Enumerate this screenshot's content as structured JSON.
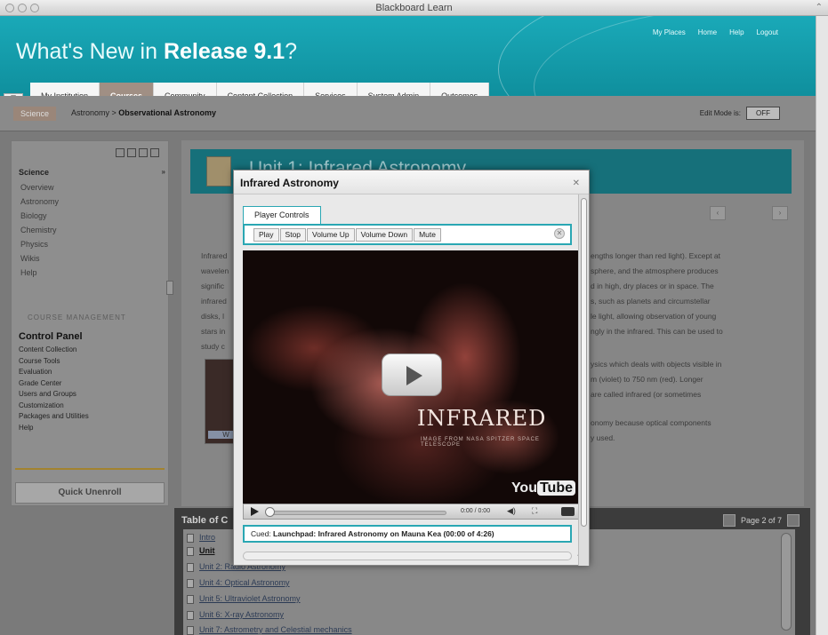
{
  "window": {
    "title": "Blackboard Learn"
  },
  "header": {
    "title_prefix": "What's New in ",
    "title_bold": "Release 9.1",
    "title_suffix": "?",
    "top_links": [
      "My Places",
      "Home",
      "Help",
      "Logout"
    ]
  },
  "tabs": [
    {
      "label": "My Institution",
      "active": false
    },
    {
      "label": "Courses",
      "active": true
    },
    {
      "label": "Community",
      "active": false
    },
    {
      "label": "Content Collection",
      "active": false
    },
    {
      "label": "Services",
      "active": false
    },
    {
      "label": "System Admin",
      "active": false
    },
    {
      "label": "Outcomes",
      "active": false
    }
  ],
  "breadcrumb": {
    "pill": "Science",
    "path": "Astronomy",
    "separator": " > ",
    "current": "Observational Astronomy",
    "edit_mode_label": "Edit Mode is:",
    "edit_mode_value": "OFF"
  },
  "sidebar": {
    "heading": "Science",
    "items": [
      "Overview",
      "Astronomy",
      "Biology",
      "Chemistry",
      "Physics",
      "Wikis",
      "Help"
    ],
    "course_management_label": "COURSE MANAGEMENT",
    "control_panel": "Control Panel",
    "cp_items": [
      "Content Collection",
      "Course Tools",
      "Evaluation",
      "Grade Center",
      "Users and Groups",
      "Customization",
      "Packages and Utilities",
      "Help"
    ],
    "quick_unenroll": "Quick Unenroll"
  },
  "content": {
    "unit_title": "Unit 1: Infrared Astronomy",
    "left_text": [
      "Infrared",
      "wavelen",
      "signific",
      "infrared",
      "disks, l",
      "stars in",
      "study c"
    ],
    "right_text": [
      "engths longer than red light). Except at",
      "sphere, and the atmosphere produces",
      "d in high, dry places or in space. The",
      "s, such as planets and circumstellar",
      "le light, allowing observation of young",
      "ngly in the infrared. This can be used to"
    ],
    "right_text2": [
      "ysics which deals with objects visible in",
      "m (violet) to 750 nm (red). Longer",
      "are called infrared (or sometimes"
    ],
    "right_text3": [
      "onomy because optical components",
      "y used."
    ],
    "thumb_label": "W"
  },
  "toc": {
    "heading": "Table of C",
    "page": "Page 2 of 7",
    "items": [
      "Intro",
      "Unit",
      "Unit 2: Radio Astronomy",
      "Unit 4: Optical Astronomy",
      "Unit 5: Ultraviolet Astronomy",
      "Unit 6: X-ray Astronomy",
      "Unit 7: Astrometry and Celestial mechanics"
    ]
  },
  "modal": {
    "title": "Infrared Astronomy",
    "tab_label": "Player Controls",
    "buttons": [
      "Play",
      "Stop",
      "Volume Up",
      "Volume Down",
      "Mute"
    ],
    "video": {
      "title": "INFRARED",
      "subtitle": "IMAGE FROM NASA SPITZER SPACE TELESCOPE",
      "logo_you": "You",
      "logo_tube": "Tube",
      "time": "0:00 / 0:00",
      "progress": 0
    },
    "cue_prefix": "Cued: ",
    "cue_text": "Launchpad: Infrared Astronomy on Mauna Kea (00:00 of 4:26)"
  }
}
